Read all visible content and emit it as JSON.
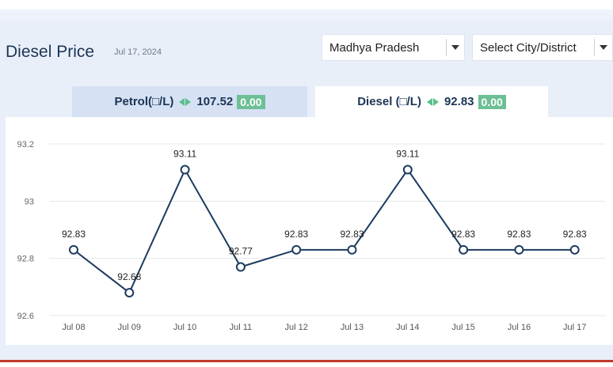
{
  "header": {
    "title": "Diesel Price",
    "date": "Jul 17, 2024",
    "state_select": "Madhya Pradesh",
    "city_select": "Select City/District"
  },
  "tabs": {
    "petrol": {
      "label": "Petrol(□/L)",
      "price": "107.52",
      "change": "0.00"
    },
    "diesel": {
      "label": "Diesel (□/L)",
      "price": "92.83",
      "change": "0.00"
    }
  },
  "colors": {
    "line": "#1c3a5e",
    "grid": "#e3e7ec",
    "badge": "#6dbf95"
  },
  "icons": [
    "up-down-triangle-icon",
    "dropdown-arrow-icon"
  ],
  "chart_data": {
    "type": "line",
    "categories": [
      "Jul 08",
      "Jul 09",
      "Jul 10",
      "Jul 11",
      "Jul 12",
      "Jul 13",
      "Jul 14",
      "Jul 15",
      "Jul 16",
      "Jul 17"
    ],
    "values": [
      92.83,
      92.68,
      93.11,
      92.77,
      92.83,
      92.83,
      93.11,
      92.83,
      92.83,
      92.83
    ],
    "labels": [
      "92.83",
      "92.68",
      "93.11",
      "92.77",
      "92.83",
      "92.83",
      "93.11",
      "92.83",
      "92.83",
      "92.83"
    ],
    "y_ticks": [
      "92.6",
      "92.8",
      "93",
      "93.2"
    ],
    "ylim": [
      92.6,
      93.2
    ],
    "grid": true
  }
}
